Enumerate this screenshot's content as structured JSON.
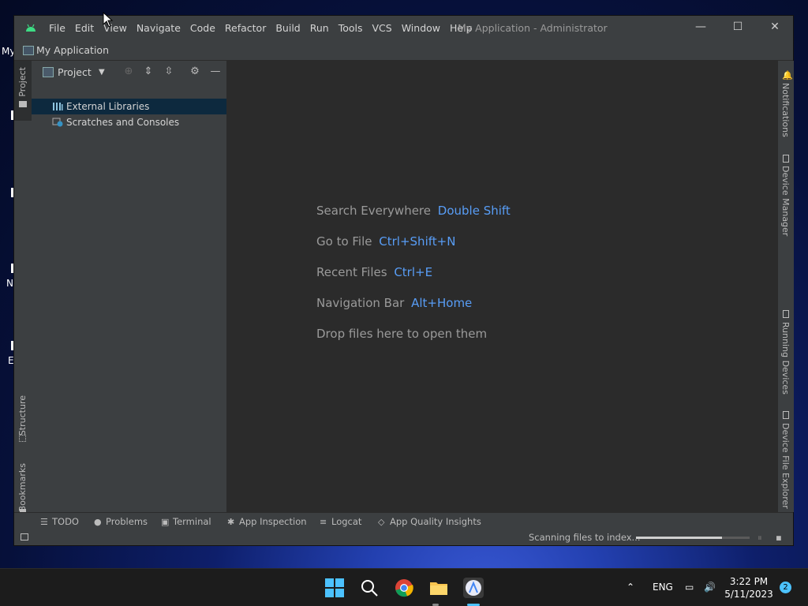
{
  "desktop": {
    "icon_labels": [
      "My",
      "N",
      "E"
    ]
  },
  "window": {
    "menu": [
      "File",
      "Edit",
      "View",
      "Navigate",
      "Code",
      "Refactor",
      "Build",
      "Run",
      "Tools",
      "VCS",
      "Window",
      "Help"
    ],
    "title": "My Application - Administrator",
    "controls": {
      "minimize": "—",
      "maximize": "☐",
      "close": "✕"
    }
  },
  "navbar": {
    "project_name": "My Application"
  },
  "left_strip": {
    "project": "Project",
    "structure": "Structure",
    "bookmarks": "Bookmarks"
  },
  "right_strip": [
    "Notifications",
    "Device Manager",
    "Running Devices",
    "Device File Explorer"
  ],
  "project_panel": {
    "title": "Project",
    "tree": [
      {
        "label": "External Libraries",
        "selected": true
      },
      {
        "label": "Scratches and Consoles",
        "selected": false
      }
    ]
  },
  "editor": {
    "hints": [
      {
        "label": "Search Everywhere",
        "key": "Double Shift"
      },
      {
        "label": "Go to File",
        "key": "Ctrl+Shift+N"
      },
      {
        "label": "Recent Files",
        "key": "Ctrl+E"
      },
      {
        "label": "Navigation Bar",
        "key": "Alt+Home"
      }
    ],
    "drop_text": "Drop files here to open them"
  },
  "bottom_tools": [
    {
      "label": "TODO",
      "icon": "list-icon"
    },
    {
      "label": "Problems",
      "icon": "info-icon"
    },
    {
      "label": "Terminal",
      "icon": "terminal-icon"
    },
    {
      "label": "App Inspection",
      "icon": "bug-icon"
    },
    {
      "label": "Logcat",
      "icon": "logcat-icon"
    },
    {
      "label": "App Quality Insights",
      "icon": "diamond-icon"
    }
  ],
  "status": {
    "text": "Scanning files to index...",
    "progress": 0.76
  },
  "taskbar": {
    "tray_lang": "ENG",
    "time": "3:22 PM",
    "date": "5/11/2023",
    "notification_count": "2"
  },
  "colors": {
    "accent_link": "#589df6",
    "selection": "#0d293e",
    "panel": "#3c3f41",
    "editor": "#2b2b2b"
  }
}
